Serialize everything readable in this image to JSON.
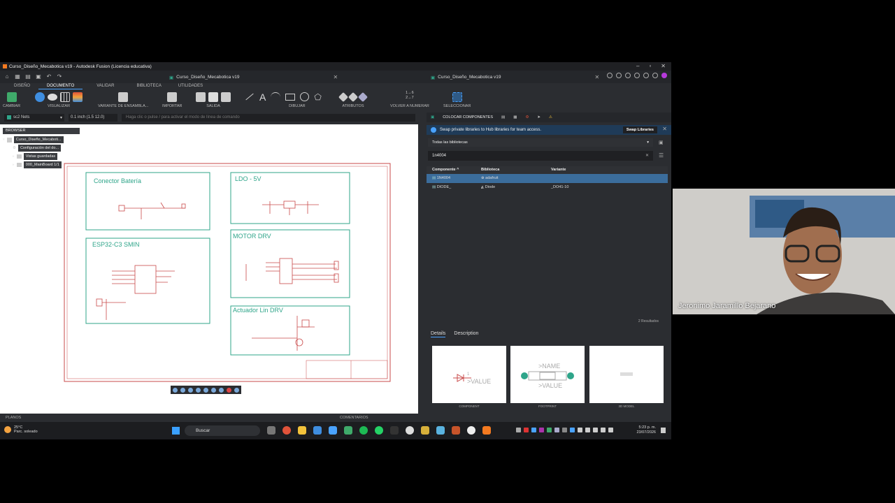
{
  "window": {
    "title": "Curso_Diseño_Mecabotica v19 - Autodesk Fusion (Licencia educativa)"
  },
  "tabs": [
    {
      "label": "Curso_Diseño_Mecabotica v19"
    },
    {
      "label": "Curso_Diseño_Mecabotica v19"
    }
  ],
  "menu_tabs": [
    "DISEÑO",
    "DOCUMENTO",
    "VALIDAR",
    "BIBLIOTECA",
    "UTILIDADES"
  ],
  "toolbar_groups": [
    "CAMBIAR",
    "VISUALIZAR",
    "VARIANTE DE ENSAMBLA...",
    "IMPORTAR",
    "SALIDA",
    "DIBUJAR",
    "ATRIBUTOS",
    "VOLVER A NUMERAR",
    "SELECCIONAR"
  ],
  "renumber_text": {
    "line1": "1→6",
    "line2": "2→7"
  },
  "layer_select": "sc2 Nets",
  "grid_value": "0.1 inch (1.5 12.0)",
  "command_placeholder": "Haga clic o pulse / para activar el modo de línea de comando",
  "browser": {
    "header": "BROWSER",
    "root": "Curso_Diseño_Mecaboti...",
    "items": [
      "Configuración del do...",
      "Vistas guardadas",
      "000_MainBoard 1/1"
    ]
  },
  "schematic": {
    "blocks": [
      "Conector Batería",
      "LDO - 5V",
      "ESP32-C3 SMIN",
      "MOTOR DRV",
      "Actuador Lin DRV"
    ]
  },
  "statusbar": {
    "left": "PLANOS",
    "center": "COMENTARIOS"
  },
  "right_panel": {
    "title": "COLOCAR COMPONENTES",
    "info_text": "Swap private libraries to Hub libraries for team access.",
    "info_button": "Swap Libraries",
    "library_select": "Todas las bibliotecas",
    "search_value": "1n4004",
    "columns": [
      "Componente ^",
      "Biblioteca",
      "Variante"
    ],
    "rows": [
      {
        "component": "1N4004",
        "library": "adafruit",
        "variant": ""
      },
      {
        "component": "DIODE_",
        "library": "Diode",
        "variant": "_DO41-10"
      }
    ],
    "result_count": "2 Resultados",
    "detail_tabs": [
      "Details",
      "Description"
    ],
    "previews": [
      {
        "label": "COMPONENT",
        "text": ">VALUE",
        "pin": "1"
      },
      {
        "label": "FOOTPRINT",
        "name": ">NAME",
        "value": ">VALUE"
      },
      {
        "label": "3D MODEL"
      }
    ]
  },
  "taskbar": {
    "temp": "25°C",
    "weather": "Parc. soleado",
    "search": "Buscar",
    "time": "5:23 p. m.",
    "date": "23/07/2026"
  },
  "video": {
    "participant": "Jeronimo Jaramillo Bejarano"
  },
  "colors": {
    "accent": "#4aa3ff",
    "schematic_green": "#2fa58a",
    "frame_red": "#c94a4a"
  }
}
